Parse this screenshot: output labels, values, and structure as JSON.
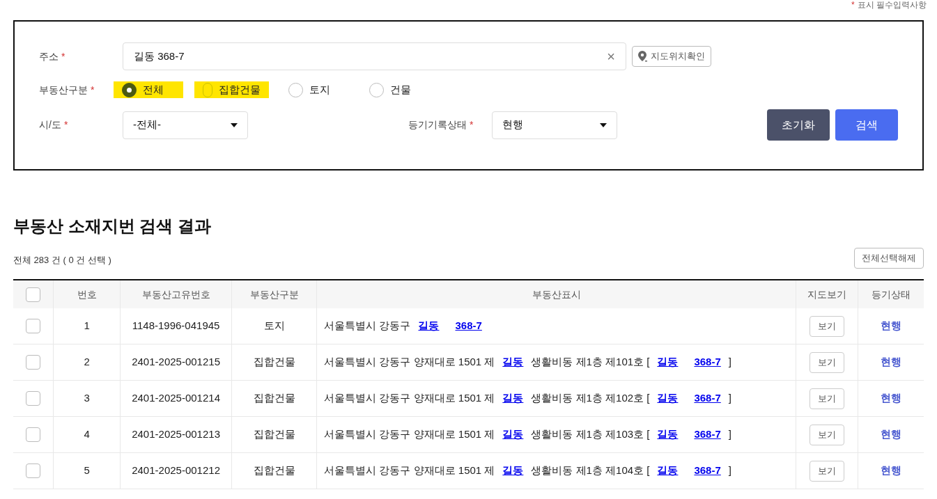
{
  "required_note": {
    "mark": "*",
    "text": "표시 필수입력사항"
  },
  "form": {
    "address": {
      "label": "주소",
      "mark": "*",
      "value": "길동 368-7",
      "clear": "×",
      "map_button": "지도위치확인"
    },
    "property_type": {
      "label": "부동산구분",
      "mark": "*",
      "options": [
        {
          "label": "전체",
          "selected": true,
          "highlighted": true
        },
        {
          "label": "집합건물",
          "selected": false,
          "highlighted": true
        },
        {
          "label": "토지",
          "selected": false,
          "highlighted": false
        },
        {
          "label": "건물",
          "selected": false,
          "highlighted": false
        }
      ]
    },
    "province": {
      "label": "시/도",
      "mark": "*",
      "value": "-전체-"
    },
    "registry_status": {
      "label": "등기기록상태",
      "mark": "*",
      "value": "현행"
    },
    "buttons": [
      {
        "kind": "reset",
        "label": "초기화"
      },
      {
        "kind": "search",
        "label": "검색"
      }
    ]
  },
  "results": {
    "title": "부동산 소재지번 검색 결과",
    "count": "전체 283 건 ( 0 건 선택 )",
    "deselect_button": "전체선택해제",
    "columns": [
      "번호",
      "부동산고유번호",
      "부동산구분",
      "부동산표시",
      "지도보기",
      "등기상태"
    ],
    "header_checked": false,
    "rows": [
      {
        "checked": false,
        "no": "1",
        "id": "1148-1996-041945",
        "type": "토지",
        "address": [
          {
            "kind": "text",
            "text": "서울특별시 강동구"
          },
          {
            "kind": "link",
            "text": "길동"
          },
          {
            "kind": "link",
            "text": "368-7"
          }
        ],
        "map": "보기",
        "status": "현행"
      },
      {
        "checked": false,
        "no": "2",
        "id": "2401-2025-001215",
        "type": "집합건물",
        "address": [
          {
            "kind": "text",
            "text": "서울특별시 강동구 양재대로 1501 제"
          },
          {
            "kind": "link",
            "text": "길동"
          },
          {
            "kind": "text",
            "text": "생활비동 제1층 제101호 ["
          },
          {
            "kind": "link",
            "text": "길동"
          },
          {
            "kind": "link",
            "text": "368-7"
          },
          {
            "kind": "text",
            "text": "]"
          }
        ],
        "map": "보기",
        "status": "현행"
      },
      {
        "checked": false,
        "no": "3",
        "id": "2401-2025-001214",
        "type": "집합건물",
        "address": [
          {
            "kind": "text",
            "text": "서울특별시 강동구 양재대로 1501 제"
          },
          {
            "kind": "link",
            "text": "길동"
          },
          {
            "kind": "text",
            "text": "생활비동 제1층 제102호 ["
          },
          {
            "kind": "link",
            "text": "길동"
          },
          {
            "kind": "link",
            "text": "368-7"
          },
          {
            "kind": "text",
            "text": "]"
          }
        ],
        "map": "보기",
        "status": "현행"
      },
      {
        "checked": false,
        "no": "4",
        "id": "2401-2025-001213",
        "type": "집합건물",
        "address": [
          {
            "kind": "text",
            "text": "서울특별시 강동구 양재대로 1501 제"
          },
          {
            "kind": "link",
            "text": "길동"
          },
          {
            "kind": "text",
            "text": "생활비동 제1층 제103호 ["
          },
          {
            "kind": "link",
            "text": "길동"
          },
          {
            "kind": "link",
            "text": "368-7"
          },
          {
            "kind": "text",
            "text": "]"
          }
        ],
        "map": "보기",
        "status": "현행"
      },
      {
        "checked": false,
        "no": "5",
        "id": "2401-2025-001212",
        "type": "집합건물",
        "address": [
          {
            "kind": "text",
            "text": "서울특별시 강동구 양재대로 1501 제"
          },
          {
            "kind": "link",
            "text": "길동"
          },
          {
            "kind": "text",
            "text": "생활비동 제1층 제104호 ["
          },
          {
            "kind": "link",
            "text": "길동"
          },
          {
            "kind": "link",
            "text": "368-7"
          },
          {
            "kind": "text",
            "text": "]"
          }
        ],
        "map": "보기",
        "status": "현행"
      }
    ]
  }
}
